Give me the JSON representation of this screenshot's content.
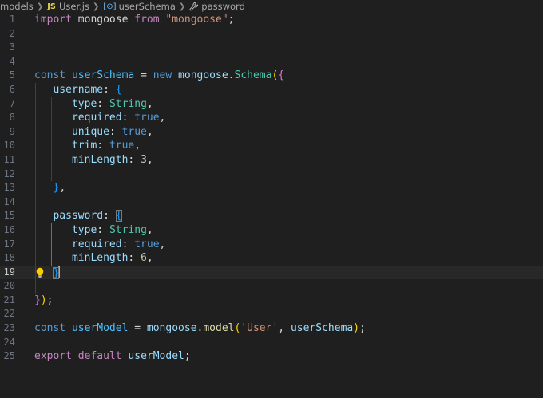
{
  "breadcrumb": {
    "folder": "models",
    "file_badge": "JS",
    "file": "User.js",
    "schema_icon": "[⊙]",
    "symbol": "userSchema",
    "property": "password"
  },
  "icons": {
    "file_type": "js-file-icon",
    "symbol_kind": "variable-symbol-icon",
    "property_kind": "wrench-icon",
    "code_action": "lightbulb-icon"
  },
  "colors": {
    "background": "#1f1f1f",
    "active_line": "#282828",
    "keyword": "#c586c0",
    "string": "#ce9178",
    "declaration": "#569cd6",
    "class": "#4ec9b0",
    "property": "#9cdcfe",
    "function": "#dcdcaa",
    "number": "#b5cea8",
    "bracket_1": "#ffd700",
    "bracket_2": "#da70d6",
    "bracket_3": "#179fff"
  },
  "editor": {
    "active_line": 19,
    "lines": [
      {
        "n": "1",
        "t": [
          [
            "import",
            "kw"
          ],
          [
            " mongoose ",
            "pl"
          ],
          [
            "from",
            "kw"
          ],
          [
            " ",
            "pl"
          ],
          [
            "\"mongoose\"",
            "st"
          ],
          [
            ";",
            "pl"
          ]
        ]
      },
      {
        "n": "2",
        "t": []
      },
      {
        "n": "3",
        "t": []
      },
      {
        "n": "4",
        "t": []
      },
      {
        "n": "5",
        "t": [
          [
            "const",
            "dc"
          ],
          [
            " ",
            "pl"
          ],
          [
            "userSchema",
            "vr"
          ],
          [
            " = ",
            "pl"
          ],
          [
            "new",
            "dc"
          ],
          [
            " ",
            "pl"
          ],
          [
            "mongoose",
            "pr"
          ],
          [
            ".",
            "pl"
          ],
          [
            "Schema",
            "cl"
          ],
          [
            "(",
            "b1"
          ],
          [
            "{",
            "b2"
          ]
        ]
      },
      {
        "n": "6",
        "t": [
          [
            "   username",
            "pr"
          ],
          [
            ": ",
            "pl"
          ],
          [
            "{",
            "b3"
          ]
        ]
      },
      {
        "n": "7",
        "t": [
          [
            "      type",
            "pr"
          ],
          [
            ": ",
            "pl"
          ],
          [
            "String",
            "cl"
          ],
          [
            ",",
            "pl"
          ]
        ]
      },
      {
        "n": "8",
        "t": [
          [
            "      required",
            "pr"
          ],
          [
            ": ",
            "pl"
          ],
          [
            "true",
            "dc"
          ],
          [
            ",",
            "pl"
          ]
        ]
      },
      {
        "n": "9",
        "t": [
          [
            "      unique",
            "pr"
          ],
          [
            ": ",
            "pl"
          ],
          [
            "true",
            "dc"
          ],
          [
            ",",
            "pl"
          ]
        ]
      },
      {
        "n": "10",
        "t": [
          [
            "      trim",
            "pr"
          ],
          [
            ": ",
            "pl"
          ],
          [
            "true",
            "dc"
          ],
          [
            ",",
            "pl"
          ]
        ]
      },
      {
        "n": "11",
        "t": [
          [
            "      minLength",
            "pr"
          ],
          [
            ": ",
            "pl"
          ],
          [
            "3",
            "nu"
          ],
          [
            ",",
            "pl"
          ]
        ]
      },
      {
        "n": "12",
        "t": []
      },
      {
        "n": "13",
        "t": [
          [
            "   ",
            "pl"
          ],
          [
            "}",
            "b3"
          ],
          [
            ",",
            "pl"
          ]
        ]
      },
      {
        "n": "14",
        "t": []
      },
      {
        "n": "15",
        "t": [
          [
            "   password",
            "pr"
          ],
          [
            ": ",
            "pl"
          ],
          [
            "{",
            "b3m"
          ]
        ]
      },
      {
        "n": "16",
        "t": [
          [
            "      type",
            "pr"
          ],
          [
            ": ",
            "pl"
          ],
          [
            "String",
            "cl"
          ],
          [
            ",",
            "pl"
          ]
        ]
      },
      {
        "n": "17",
        "t": [
          [
            "      required",
            "pr"
          ],
          [
            ": ",
            "pl"
          ],
          [
            "true",
            "dc"
          ],
          [
            ",",
            "pl"
          ]
        ]
      },
      {
        "n": "18",
        "t": [
          [
            "      minLength",
            "pr"
          ],
          [
            ": ",
            "pl"
          ],
          [
            "6",
            "nu"
          ],
          [
            ",",
            "pl"
          ]
        ]
      },
      {
        "n": "19",
        "t": [
          [
            "   ",
            "pl"
          ],
          [
            "}",
            "b3m"
          ]
        ]
      },
      {
        "n": "20",
        "t": []
      },
      {
        "n": "21",
        "t": [
          [
            "}",
            "b2"
          ],
          [
            ")",
            "b1"
          ],
          [
            ";",
            "pl"
          ]
        ]
      },
      {
        "n": "22",
        "t": []
      },
      {
        "n": "23",
        "t": [
          [
            "const",
            "dc"
          ],
          [
            " ",
            "pl"
          ],
          [
            "userModel",
            "vr"
          ],
          [
            " = ",
            "pl"
          ],
          [
            "mongoose",
            "pr"
          ],
          [
            ".",
            "pl"
          ],
          [
            "model",
            "fn"
          ],
          [
            "(",
            "b1"
          ],
          [
            "'User'",
            "st"
          ],
          [
            ", ",
            "pl"
          ],
          [
            "userSchema",
            "pr"
          ],
          [
            ")",
            "b1"
          ],
          [
            ";",
            "pl"
          ]
        ]
      },
      {
        "n": "24",
        "t": []
      },
      {
        "n": "25",
        "t": [
          [
            "export",
            "kw"
          ],
          [
            " ",
            "pl"
          ],
          [
            "default",
            "kw"
          ],
          [
            " ",
            "pl"
          ],
          [
            "userModel",
            "pr"
          ],
          [
            ";",
            "pl"
          ]
        ]
      }
    ]
  }
}
